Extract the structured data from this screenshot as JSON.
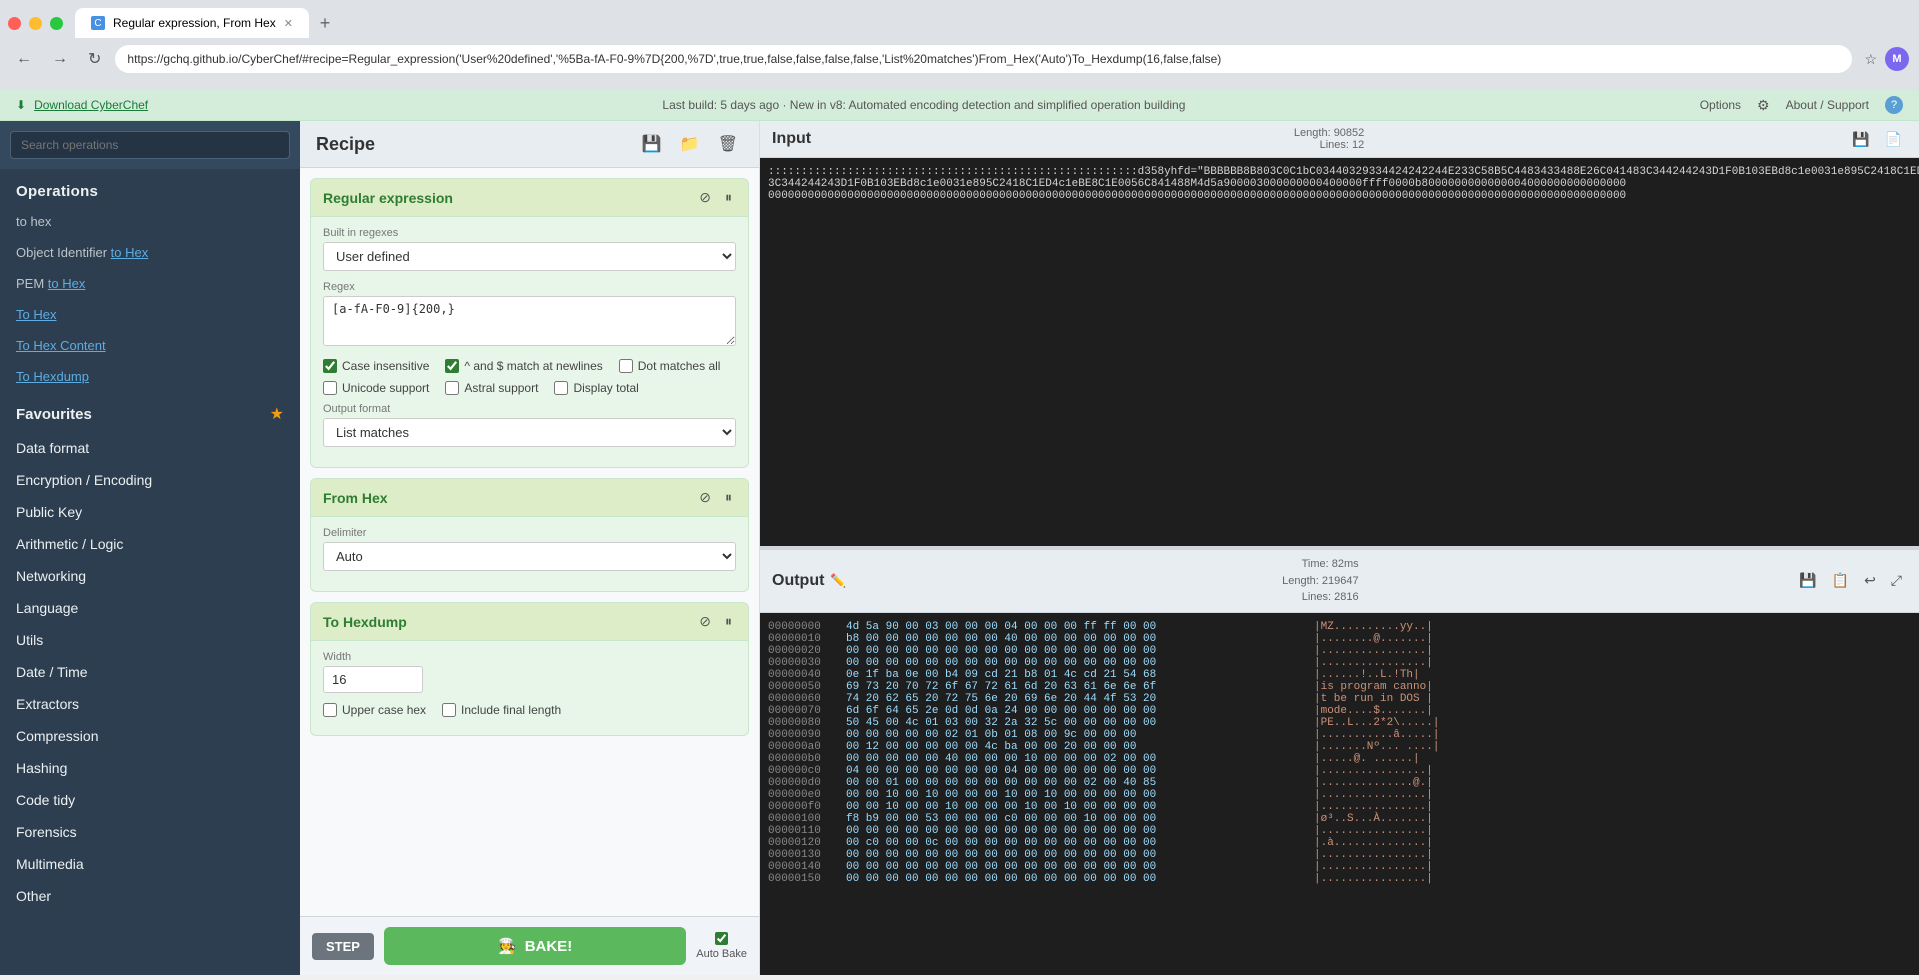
{
  "browser": {
    "tab_label": "Regular expression, From Hex",
    "url": "https://gchq.github.io/CyberChef/#recipe=Regular_expression('User%20defined','%5Ba-fA-F0-9%7D{200,%7D',true,true,false,false,false,false,'List%20matches')From_Hex('Auto')To_Hexdump(16,false,false)",
    "nav_back": "←",
    "nav_forward": "→",
    "nav_refresh": "↻",
    "profile_initials": "M"
  },
  "notification": {
    "left": "Download CyberChef",
    "center": "Last build: 5 days ago · New in v8: Automated encoding detection and simplified operation building",
    "options": "Options",
    "about_support": "About / Support"
  },
  "sidebar": {
    "search_placeholder": "Search operations",
    "categories": [
      {
        "name": "Operations",
        "items": []
      }
    ],
    "items": [
      {
        "label": "to hex",
        "type": "plain"
      },
      {
        "label": "Object Identifier to Hex",
        "type": "link",
        "link_part": "to Hex"
      },
      {
        "label": "PEM to Hex",
        "type": "link",
        "link_part": "to Hex"
      },
      {
        "label": "To Hex",
        "type": "link",
        "link_part": "To Hex"
      },
      {
        "label": "To Hex Content",
        "type": "link",
        "link_part": ""
      },
      {
        "label": "To Hexdump",
        "type": "link",
        "link_part": ""
      },
      {
        "label": "Favourites",
        "type": "favourites"
      },
      {
        "label": "Data format",
        "type": "category"
      },
      {
        "label": "Encryption / Encoding",
        "type": "category"
      },
      {
        "label": "Public Key",
        "type": "category"
      },
      {
        "label": "Arithmetic / Logic",
        "type": "category"
      },
      {
        "label": "Networking",
        "type": "category"
      },
      {
        "label": "Language",
        "type": "category"
      },
      {
        "label": "Utils",
        "type": "category"
      },
      {
        "label": "Date / Time",
        "type": "category"
      },
      {
        "label": "Extractors",
        "type": "category"
      },
      {
        "label": "Compression",
        "type": "category"
      },
      {
        "label": "Hashing",
        "type": "category"
      },
      {
        "label": "Code tidy",
        "type": "category"
      },
      {
        "label": "Forensics",
        "type": "category"
      },
      {
        "label": "Multimedia",
        "type": "category"
      },
      {
        "label": "Other",
        "type": "category"
      }
    ]
  },
  "recipe": {
    "title": "Recipe",
    "save_label": "💾",
    "load_label": "📁",
    "clear_label": "🗑",
    "operations": [
      {
        "id": "regex",
        "title": "Regular expression",
        "fields": [
          {
            "label": "Built in regexes",
            "type": "select",
            "value": "User defined",
            "name": "builtin_regexes"
          },
          {
            "label": "Regex",
            "type": "textarea",
            "value": "[a-fA-F0-9]{200,}",
            "name": "regex_value"
          }
        ],
        "checkboxes": [
          {
            "label": "Case insensitive",
            "checked": true,
            "name": "case_insensitive"
          },
          {
            "label": "^ and $ match at newlines",
            "checked": true,
            "name": "multiline"
          },
          {
            "label": "Dot matches all",
            "checked": false,
            "name": "dot_all"
          },
          {
            "label": "Unicode support",
            "checked": false,
            "name": "unicode_support"
          },
          {
            "label": "Astral support",
            "checked": false,
            "name": "astral_support"
          },
          {
            "label": "Display total",
            "checked": false,
            "name": "display_total"
          }
        ],
        "output_format_label": "Output format",
        "output_format_value": "List matches"
      },
      {
        "id": "from_hex",
        "title": "From Hex",
        "fields": [
          {
            "label": "Delimiter",
            "type": "select",
            "value": "Auto",
            "name": "delimiter"
          }
        ]
      },
      {
        "id": "to_hexdump",
        "title": "To Hexdump",
        "fields": [
          {
            "label": "Width",
            "type": "number",
            "value": "16",
            "name": "width"
          }
        ],
        "checkboxes": [
          {
            "label": "Upper case hex",
            "checked": false,
            "name": "upper_case"
          },
          {
            "label": "Include final length",
            "checked": false,
            "name": "include_final_length"
          }
        ]
      }
    ],
    "step_label": "STEP",
    "bake_label": "🧑‍🍳  BAKE!",
    "auto_bake_label": "Auto Bake",
    "auto_bake_checked": true
  },
  "input": {
    "title": "Input",
    "length": "90852",
    "lines": "12",
    "content": "::::::::::::::::::::::::::::::::::::::::::::::::::::::::d358yhfd=\"BBBBBB8B803C0C1bC03440329334424242\n44E233C58B5C4483433488E26C04148 3C344244243D1F0B103EBd8c1e0031e895C2418C1ED4c1eBE8C1E0056C841488M4d5a9000030000000\n4000000fff0000b800000000000000000000000"
  },
  "output": {
    "title": "Output",
    "edit_icon": "✏️",
    "time": "82ms",
    "length": "219647",
    "lines": "2816",
    "hexdump_lines": [
      {
        "addr": "00000000",
        "bytes": "4d 5a 90 00 03 00 00 00 04 00 00 00 ff ff 00 00",
        "ascii": "|MZ..........yy..|"
      },
      {
        "addr": "00000010",
        "bytes": "b8 00 00 00 00 00 00 00 40 00 00 00 00 00 00 00",
        "ascii": "|........@.......|"
      },
      {
        "addr": "00000020",
        "bytes": "00 00 00 00 00 00 00 00 00 00 00 00 00 00 00 00",
        "ascii": "|................|"
      },
      {
        "addr": "00000030",
        "bytes": "00 00 00 00 00 00 00 00 00 00 00 00 00 00 00 00",
        "ascii": "|................|"
      },
      {
        "addr": "00000040",
        "bytes": "0e 1f ba 0e 00 b4 09 cd 21 b8 01 4c cd 21 54 68",
        "ascii": "|......!..L.!Th|"
      },
      {
        "addr": "00000050",
        "bytes": "69 73 20 70 72 6f 67 72 61 6d 20 63 61 6e 6e 6f",
        "ascii": "|is program canno|"
      },
      {
        "addr": "00000060",
        "bytes": "74 20 62 65 20 72 75 6e 20 69 6e 20 44 4f 53 20",
        "ascii": "|t be run in DOS |"
      },
      {
        "addr": "00000070",
        "bytes": "6d 6f 64 65 2e 0d 0d 0a 24 00 00 00 00 00 00 00",
        "ascii": "|mode....$.......| "
      },
      {
        "addr": "00000080",
        "bytes": "50 45 00 4c 01 03 00 32 2a 32 5c 00 00 00 00 00",
        "ascii": "|PE..L...2*2\\.....|"
      },
      {
        "addr": "00000090",
        "bytes": "00 00 00 00 00 02 01 0b 01 08 00 9c 00 00 00",
        "ascii": "|...........â.....|"
      },
      {
        "addr": "000000a0",
        "bytes": "00 12 00 00 00 00 00 4c ba 00 00 20 00 00 00",
        "ascii": "|.......Nº... ....|"
      },
      {
        "addr": "000000b0",
        "bytes": "00 00 00 00 00 40 00 00 00 10 00 00 00 02 00 00",
        "ascii": "|.....@. ......|"
      },
      {
        "addr": "000000c0",
        "bytes": "04 00 00 00 00 00 00 00 04 00 00 00 00 00 00 00",
        "ascii": "|................|"
      },
      {
        "addr": "000000d0",
        "bytes": "00 00 01 00 00 00 00 00 00 00 00 00 02 00 40 85",
        "ascii": "|..............@.|"
      },
      {
        "addr": "000000e0",
        "bytes": "00 00 10 00 10 00 00 00 10 00 10 00 00 00 00 00",
        "ascii": "|................|"
      },
      {
        "addr": "000000f0",
        "bytes": "00 00 10 00 00 10 00 00 00 10 00 10 00 00 00 00",
        "ascii": "|................|"
      },
      {
        "addr": "00000100",
        "bytes": "f8 b9 00 00 53 00 00 00 c0 00 00 00 10 00 00 00",
        "ascii": "|ø³..S...À.......|"
      },
      {
        "addr": "00000110",
        "bytes": "00 00 00 00 00 00 00 00 00 00 00 00 00 00 00 00",
        "ascii": "|................|"
      },
      {
        "addr": "00000120",
        "bytes": "00 c0 00 00 0c 00 00 00 00 00 00 00 00 00 00 00",
        "ascii": "|.à..............|"
      },
      {
        "addr": "00000130",
        "bytes": "00 00 00 00 00 00 00 00 00 00 00 00 00 00 00 00",
        "ascii": "|................|"
      },
      {
        "addr": "00000140",
        "bytes": "00 00 00 00 00 00 00 00 00 00 00 00 00 00 00 00",
        "ascii": "|................|"
      },
      {
        "addr": "00000150",
        "bytes": "00 00 00 00 00 00 00 00 00 00 00 00 00 00 00 00",
        "ascii": "|................|"
      }
    ]
  }
}
